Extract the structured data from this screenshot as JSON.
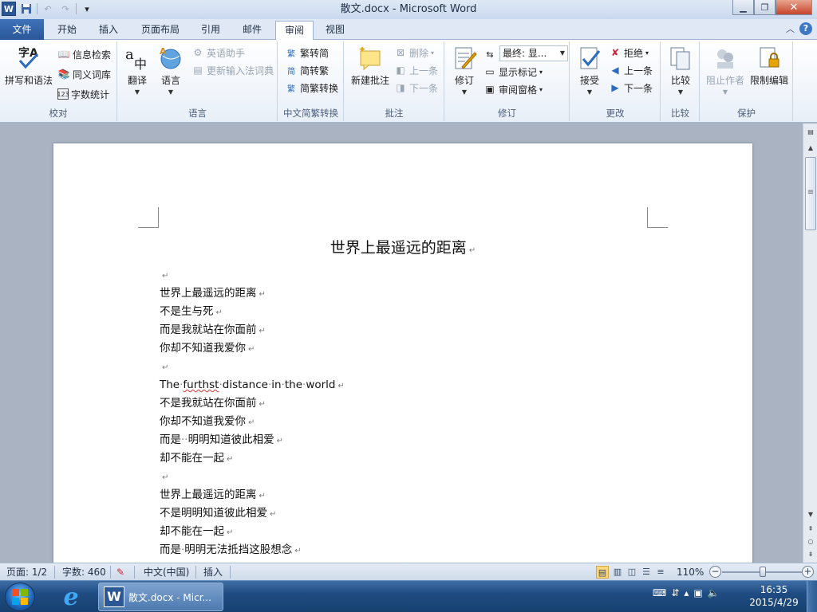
{
  "titlebar": {
    "title": "散文.docx - Microsoft Word",
    "app_letter": "W",
    "min_glyph": "▁",
    "max_glyph": "❐",
    "close_glyph": "✕"
  },
  "tabs": {
    "file": "文件",
    "items": [
      "开始",
      "插入",
      "页面布局",
      "引用",
      "邮件",
      "审阅",
      "视图"
    ],
    "active_index": 5
  },
  "ribbon": {
    "proofing": {
      "label": "校对",
      "spelling": "拼写和语法",
      "research": "信息检索",
      "thesaurus": "同义词库",
      "wordcount": "字数统计"
    },
    "language": {
      "label": "语言",
      "translate": "翻译",
      "language": "语言",
      "english_assistant": "英语助手",
      "update_ime": "更新输入法词典"
    },
    "chinese_conversion": {
      "label": "中文简繁转换",
      "to_simplified": "繁转简",
      "to_traditional": "简转繁",
      "conversion": "简繁转换"
    },
    "comments": {
      "label": "批注",
      "new_comment": "新建批注",
      "delete": "删除",
      "previous": "上一条",
      "next": "下一条"
    },
    "tracking": {
      "label": "修订",
      "track_changes": "修订",
      "display_for_review": "最终: 显...",
      "show_markup": "显示标记",
      "reviewing_pane": "审阅窗格"
    },
    "changes": {
      "label": "更改",
      "accept": "接受",
      "reject": "拒绝",
      "previous": "上一条",
      "next": "下一条"
    },
    "compare": {
      "label": "比较",
      "compare": "比较"
    },
    "protect": {
      "label": "保护",
      "block_authors": "阻止作者",
      "restrict_editing": "限制编辑"
    }
  },
  "document": {
    "heading": "世界上最遥远的距离",
    "lines": [
      "",
      "世界上最遥远的距离",
      "不是生与死",
      "而是我就站在你面前",
      "你却不知道我爱你",
      "",
      "The furthst distance in the world",
      "不是我就站在你面前",
      "你却不知道我爱你",
      "而是  明明知道彼此相爱",
      "却不能在一起",
      "",
      "世界上最遥远的距离",
      "不是明明知道彼此相爱",
      "却不能在一起",
      "而是 明明无法抵挡这股想念"
    ],
    "paragraph_mark": "↵"
  },
  "statusbar": {
    "page": "页面: 1/2",
    "words": "字数: 460",
    "language": "中文(中国)",
    "insert_mode": "插入",
    "zoom": "110%",
    "zoom_minus": "−",
    "zoom_plus": "+"
  },
  "taskbar": {
    "word_item": "散文.docx - Micr...",
    "time": "16:35",
    "date": "2015/4/29"
  }
}
